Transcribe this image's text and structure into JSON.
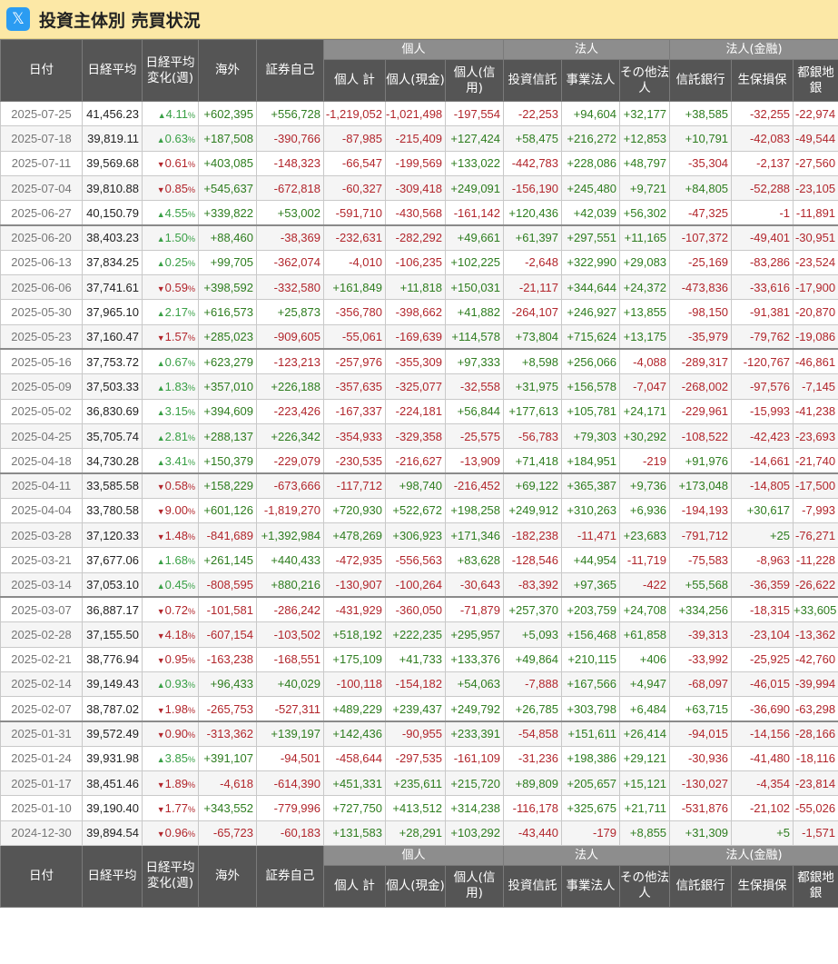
{
  "page": {
    "title": "投資主体別 売買状況",
    "logo_icon": "x-logo-icon",
    "logo_glyph": "𝕏"
  },
  "colors": {
    "title_bg": "#fce8a6",
    "header_bg": "#555555",
    "group_header_bg": "#8d8d8d",
    "positive": "#2e7d1f",
    "negative": "#b2262c",
    "up_arrow": "#39a046"
  },
  "headers": {
    "date": "日付",
    "nikkei": "日経平均",
    "nikkei_change": "日経平均変化(週)",
    "foreign": "海外",
    "proprietary": "証券自己",
    "groups": {
      "individual": "個人",
      "corporate": "法人",
      "financial": "法人(金融)"
    },
    "indiv_total": "個人 計",
    "indiv_cash": "個人(現金)",
    "indiv_margin": "個人(信用)",
    "trust": "投資信託",
    "business": "事業法人",
    "other_corp": "その他法人",
    "trust_bank": "信託銀行",
    "life_ins": "生保損保",
    "regional_bank": "都銀地銀"
  },
  "rows": [
    {
      "date": "2025-07-25",
      "nikkei": "41,456.23",
      "chg_dir": "up",
      "chg": "4.11",
      "vals": [
        "+602,395",
        "+556,728",
        "-1,219,052",
        "-1,021,498",
        "-197,554",
        "-22,253",
        "+94,604",
        "+32,177",
        "+38,585",
        "-32,255",
        "-22,974"
      ]
    },
    {
      "date": "2025-07-18",
      "nikkei": "39,819.11",
      "chg_dir": "up",
      "chg": "0.63",
      "vals": [
        "+187,508",
        "-390,766",
        "-87,985",
        "-215,409",
        "+127,424",
        "+58,475",
        "+216,272",
        "+12,853",
        "+10,791",
        "-42,083",
        "-49,544"
      ]
    },
    {
      "date": "2025-07-11",
      "nikkei": "39,569.68",
      "chg_dir": "dn",
      "chg": "0.61",
      "vals": [
        "+403,085",
        "-148,323",
        "-66,547",
        "-199,569",
        "+133,022",
        "-442,783",
        "+228,086",
        "+48,797",
        "-35,304",
        "-2,137",
        "-27,560"
      ]
    },
    {
      "date": "2025-07-04",
      "nikkei": "39,810.88",
      "chg_dir": "dn",
      "chg": "0.85",
      "vals": [
        "+545,637",
        "-672,818",
        "-60,327",
        "-309,418",
        "+249,091",
        "-156,190",
        "+245,480",
        "+9,721",
        "+84,805",
        "-52,288",
        "-23,105"
      ]
    },
    {
      "date": "2025-06-27",
      "nikkei": "40,150.79",
      "chg_dir": "up",
      "chg": "4.55",
      "vals": [
        "+339,822",
        "+53,002",
        "-591,710",
        "-430,568",
        "-161,142",
        "+120,436",
        "+42,039",
        "+56,302",
        "-47,325",
        "-1",
        "-11,891"
      ]
    },
    {
      "date": "2025-06-20",
      "nikkei": "38,403.23",
      "chg_dir": "up",
      "chg": "1.50",
      "vals": [
        "+88,460",
        "-38,369",
        "-232,631",
        "-282,292",
        "+49,661",
        "+61,397",
        "+297,551",
        "+11,165",
        "-107,372",
        "-49,401",
        "-30,951"
      ]
    },
    {
      "date": "2025-06-13",
      "nikkei": "37,834.25",
      "chg_dir": "up",
      "chg": "0.25",
      "vals": [
        "+99,705",
        "-362,074",
        "-4,010",
        "-106,235",
        "+102,225",
        "-2,648",
        "+322,990",
        "+29,083",
        "-25,169",
        "-83,286",
        "-23,524"
      ]
    },
    {
      "date": "2025-06-06",
      "nikkei": "37,741.61",
      "chg_dir": "dn",
      "chg": "0.59",
      "vals": [
        "+398,592",
        "-332,580",
        "+161,849",
        "+11,818",
        "+150,031",
        "-21,117",
        "+344,644",
        "+24,372",
        "-473,836",
        "-33,616",
        "-17,900"
      ]
    },
    {
      "date": "2025-05-30",
      "nikkei": "37,965.10",
      "chg_dir": "up",
      "chg": "2.17",
      "vals": [
        "+616,573",
        "+25,873",
        "-356,780",
        "-398,662",
        "+41,882",
        "-264,107",
        "+246,927",
        "+13,855",
        "-98,150",
        "-91,381",
        "-20,870"
      ]
    },
    {
      "date": "2025-05-23",
      "nikkei": "37,160.47",
      "chg_dir": "dn",
      "chg": "1.57",
      "vals": [
        "+285,023",
        "-909,605",
        "-55,061",
        "-169,639",
        "+114,578",
        "+73,804",
        "+715,624",
        "+13,175",
        "-35,979",
        "-79,762",
        "-19,086"
      ]
    },
    {
      "date": "2025-05-16",
      "nikkei": "37,753.72",
      "chg_dir": "up",
      "chg": "0.67",
      "vals": [
        "+623,279",
        "-123,213",
        "-257,976",
        "-355,309",
        "+97,333",
        "+8,598",
        "+256,066",
        "-4,088",
        "-289,317",
        "-120,767",
        "-46,861"
      ]
    },
    {
      "date": "2025-05-09",
      "nikkei": "37,503.33",
      "chg_dir": "up",
      "chg": "1.83",
      "vals": [
        "+357,010",
        "+226,188",
        "-357,635",
        "-325,077",
        "-32,558",
        "+31,975",
        "+156,578",
        "-7,047",
        "-268,002",
        "-97,576",
        "-7,145"
      ]
    },
    {
      "date": "2025-05-02",
      "nikkei": "36,830.69",
      "chg_dir": "up",
      "chg": "3.15",
      "vals": [
        "+394,609",
        "-223,426",
        "-167,337",
        "-224,181",
        "+56,844",
        "+177,613",
        "+105,781",
        "+24,171",
        "-229,961",
        "-15,993",
        "-41,238"
      ]
    },
    {
      "date": "2025-04-25",
      "nikkei": "35,705.74",
      "chg_dir": "up",
      "chg": "2.81",
      "vals": [
        "+288,137",
        "+226,342",
        "-354,933",
        "-329,358",
        "-25,575",
        "-56,783",
        "+79,303",
        "+30,292",
        "-108,522",
        "-42,423",
        "-23,693"
      ]
    },
    {
      "date": "2025-04-18",
      "nikkei": "34,730.28",
      "chg_dir": "up",
      "chg": "3.41",
      "vals": [
        "+150,379",
        "-229,079",
        "-230,535",
        "-216,627",
        "-13,909",
        "+71,418",
        "+184,951",
        "-219",
        "+91,976",
        "-14,661",
        "-21,740"
      ]
    },
    {
      "date": "2025-04-11",
      "nikkei": "33,585.58",
      "chg_dir": "dn",
      "chg": "0.58",
      "vals": [
        "+158,229",
        "-673,666",
        "-117,712",
        "+98,740",
        "-216,452",
        "+69,122",
        "+365,387",
        "+9,736",
        "+173,048",
        "-14,805",
        "-17,500"
      ]
    },
    {
      "date": "2025-04-04",
      "nikkei": "33,780.58",
      "chg_dir": "dn",
      "chg": "9.00",
      "vals": [
        "+601,126",
        "-1,819,270",
        "+720,930",
        "+522,672",
        "+198,258",
        "+249,912",
        "+310,263",
        "+6,936",
        "-194,193",
        "+30,617",
        "-7,993"
      ]
    },
    {
      "date": "2025-03-28",
      "nikkei": "37,120.33",
      "chg_dir": "dn",
      "chg": "1.48",
      "vals": [
        "-841,689",
        "+1,392,984",
        "+478,269",
        "+306,923",
        "+171,346",
        "-182,238",
        "-11,471",
        "+23,683",
        "-791,712",
        "+25",
        "-76,271"
      ]
    },
    {
      "date": "2025-03-21",
      "nikkei": "37,677.06",
      "chg_dir": "up",
      "chg": "1.68",
      "vals": [
        "+261,145",
        "+440,433",
        "-472,935",
        "-556,563",
        "+83,628",
        "-128,546",
        "+44,954",
        "-11,719",
        "-75,583",
        "-8,963",
        "-11,228"
      ]
    },
    {
      "date": "2025-03-14",
      "nikkei": "37,053.10",
      "chg_dir": "up",
      "chg": "0.45",
      "vals": [
        "-808,595",
        "+880,216",
        "-130,907",
        "-100,264",
        "-30,643",
        "-83,392",
        "+97,365",
        "-422",
        "+55,568",
        "-36,359",
        "-26,622"
      ]
    },
    {
      "date": "2025-03-07",
      "nikkei": "36,887.17",
      "chg_dir": "dn",
      "chg": "0.72",
      "vals": [
        "-101,581",
        "-286,242",
        "-431,929",
        "-360,050",
        "-71,879",
        "+257,370",
        "+203,759",
        "+24,708",
        "+334,256",
        "-18,315",
        "+33,605"
      ]
    },
    {
      "date": "2025-02-28",
      "nikkei": "37,155.50",
      "chg_dir": "dn",
      "chg": "4.18",
      "vals": [
        "-607,154",
        "-103,502",
        "+518,192",
        "+222,235",
        "+295,957",
        "+5,093",
        "+156,468",
        "+61,858",
        "-39,313",
        "-23,104",
        "-13,362"
      ]
    },
    {
      "date": "2025-02-21",
      "nikkei": "38,776.94",
      "chg_dir": "dn",
      "chg": "0.95",
      "vals": [
        "-163,238",
        "-168,551",
        "+175,109",
        "+41,733",
        "+133,376",
        "+49,864",
        "+210,115",
        "+406",
        "-33,992",
        "-25,925",
        "-42,760"
      ]
    },
    {
      "date": "2025-02-14",
      "nikkei": "39,149.43",
      "chg_dir": "up",
      "chg": "0.93",
      "vals": [
        "+96,433",
        "+40,029",
        "-100,118",
        "-154,182",
        "+54,063",
        "-7,888",
        "+167,566",
        "+4,947",
        "-68,097",
        "-46,015",
        "-39,994"
      ]
    },
    {
      "date": "2025-02-07",
      "nikkei": "38,787.02",
      "chg_dir": "dn",
      "chg": "1.98",
      "vals": [
        "-265,753",
        "-527,311",
        "+489,229",
        "+239,437",
        "+249,792",
        "+26,785",
        "+303,798",
        "+6,484",
        "+63,715",
        "-36,690",
        "-63,298"
      ]
    },
    {
      "date": "2025-01-31",
      "nikkei": "39,572.49",
      "chg_dir": "dn",
      "chg": "0.90",
      "vals": [
        "-313,362",
        "+139,197",
        "+142,436",
        "-90,955",
        "+233,391",
        "-54,858",
        "+151,611",
        "+26,414",
        "-94,015",
        "-14,156",
        "-28,166"
      ]
    },
    {
      "date": "2025-01-24",
      "nikkei": "39,931.98",
      "chg_dir": "up",
      "chg": "3.85",
      "vals": [
        "+391,107",
        "-94,501",
        "-458,644",
        "-297,535",
        "-161,109",
        "-31,236",
        "+198,386",
        "+29,121",
        "-30,936",
        "-41,480",
        "-18,116"
      ]
    },
    {
      "date": "2025-01-17",
      "nikkei": "38,451.46",
      "chg_dir": "dn",
      "chg": "1.89",
      "vals": [
        "-4,618",
        "-614,390",
        "+451,331",
        "+235,611",
        "+215,720",
        "+89,809",
        "+205,657",
        "+15,121",
        "-130,027",
        "-4,354",
        "-23,814"
      ]
    },
    {
      "date": "2025-01-10",
      "nikkei": "39,190.40",
      "chg_dir": "dn",
      "chg": "1.77",
      "vals": [
        "+343,552",
        "-779,996",
        "+727,750",
        "+413,512",
        "+314,238",
        "-116,178",
        "+325,675",
        "+21,711",
        "-531,876",
        "-21,102",
        "-55,026"
      ]
    },
    {
      "date": "2024-12-30",
      "nikkei": "39,894.54",
      "chg_dir": "dn",
      "chg": "0.96",
      "vals": [
        "-65,723",
        "-60,183",
        "+131,583",
        "+28,291",
        "+103,292",
        "-43,440",
        "-179",
        "+8,855",
        "+31,309",
        "+5",
        "-1,571"
      ]
    }
  ],
  "arrow_up": "▲",
  "arrow_down": "▼",
  "pct_sign": "%"
}
